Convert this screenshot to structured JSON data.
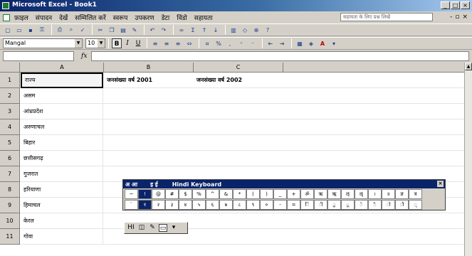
{
  "window": {
    "title": "Microsoft Excel - Book1",
    "controls": [
      "_",
      "□",
      "×"
    ]
  },
  "menubar": {
    "items": [
      "फ़ाइल",
      "संपादन",
      "देखें",
      "सम्मिलित करें",
      "स्वरूप",
      "उपकरण",
      "डेटा",
      "विंडो",
      "सहायता"
    ],
    "help_placeholder": "सहायता के लिए प्रश्न लिखें",
    "doc_controls": [
      "-",
      "▫",
      "×"
    ]
  },
  "formatting": {
    "font_name": "Mangal",
    "font_size": "10",
    "bold": "B",
    "italic": "I",
    "underline": "U"
  },
  "formula_bar": {
    "fx": "fx",
    "name_box": "",
    "value": ""
  },
  "sheet": {
    "columns": [
      "A",
      "B",
      "C"
    ],
    "header_cells": {
      "B1": "जनसंख्या वर्ष 2001",
      "C1": "जनसंख्या वर्ष 2002"
    },
    "rows": [
      {
        "num": "1",
        "a": "राज्य"
      },
      {
        "num": "2",
        "a": "असम"
      },
      {
        "num": "3",
        "a": "आंध्रप्रदेश"
      },
      {
        "num": "4",
        "a": "अरुणाचल"
      },
      {
        "num": "5",
        "a": "बिहार"
      },
      {
        "num": "6",
        "a": "छत्तीसगढ़"
      },
      {
        "num": "7",
        "a": "गुजरात"
      },
      {
        "num": "8",
        "a": "हरियाणा"
      },
      {
        "num": "9",
        "a": "हिमाचल"
      },
      {
        "num": "10",
        "a": "केरल"
      },
      {
        "num": "11",
        "a": "गोवा"
      }
    ]
  },
  "palette": {
    "title_left": "अ आ",
    "title_mid": "इ ई",
    "title_right": "Hindi Keyboard",
    "row1": [
      "~",
      "!",
      "@",
      "#",
      "$",
      "%",
      "^",
      "&",
      "*",
      "(",
      ")",
      "_",
      "+",
      "ॐ",
      "ऋ",
      "ॠ",
      "ऌ",
      "ॡ",
      "।",
      "॥",
      "ज्ञ",
      "त्र"
    ],
    "row2": [
      "`",
      "१",
      "२",
      "३",
      "४",
      "५",
      "६",
      "७",
      "८",
      "९",
      "०",
      "-",
      "=",
      "ि",
      "ी",
      "ु",
      "ू",
      "े",
      "ै",
      "ो",
      "ौ",
      "्"
    ]
  },
  "langbar": {
    "lang": "HI",
    "icon2": "◫",
    "icon3": "✎",
    "icon4": "▭",
    "icon5": "▾"
  }
}
